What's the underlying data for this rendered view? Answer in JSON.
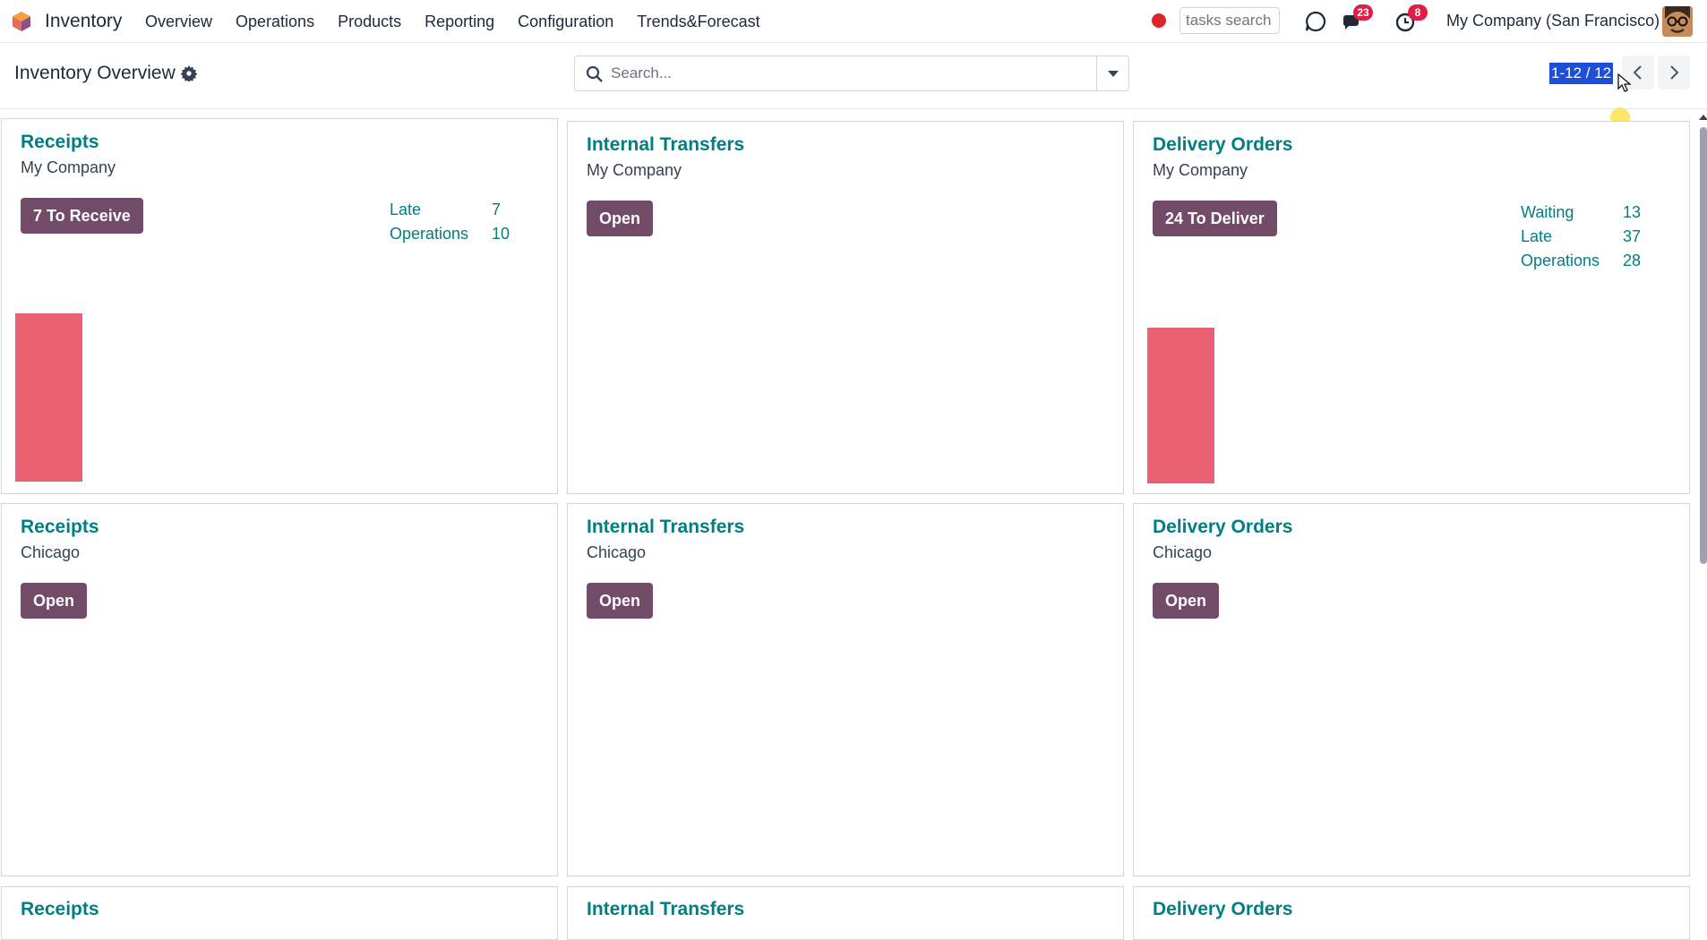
{
  "navbar": {
    "app_name": "Inventory",
    "menu": [
      "Overview",
      "Operations",
      "Products",
      "Reporting",
      "Configuration",
      "Trends&Forecast"
    ],
    "tasks_search_placeholder": "tasks search",
    "messages_count": "23",
    "activities_count": "8",
    "company": "My Company (San Francisco)"
  },
  "control": {
    "title": "Inventory Overview",
    "search_placeholder": "Search...",
    "pager": "1-12 / 12"
  },
  "cards": [
    {
      "title": "Receipts",
      "subtitle": "My Company",
      "button": "7 To Receive",
      "stats": [
        {
          "label": "Late",
          "value": "7"
        },
        {
          "label": "Operations",
          "value": "10"
        }
      ]
    },
    {
      "title": "Internal Transfers",
      "subtitle": "My Company",
      "button": "Open",
      "stats": []
    },
    {
      "title": "Delivery Orders",
      "subtitle": "My Company",
      "button": "24 To Deliver",
      "stats": [
        {
          "label": "Waiting",
          "value": "13"
        },
        {
          "label": "Late",
          "value": "37"
        },
        {
          "label": "Operations",
          "value": "28"
        }
      ]
    },
    {
      "title": "Receipts",
      "subtitle": "Chicago",
      "button": "Open",
      "stats": []
    },
    {
      "title": "Internal Transfers",
      "subtitle": "Chicago",
      "button": "Open",
      "stats": []
    },
    {
      "title": "Delivery Orders",
      "subtitle": "Chicago",
      "button": "Open",
      "stats": []
    },
    {
      "title": "Receipts",
      "subtitle": "",
      "button": "",
      "stats": []
    },
    {
      "title": "Internal Transfers",
      "subtitle": "",
      "button": "",
      "stats": []
    },
    {
      "title": "Delivery Orders",
      "subtitle": "",
      "button": "",
      "stats": []
    }
  ],
  "colors": {
    "brand": "#714b67",
    "link": "#017e84",
    "bar": "#e96173",
    "badge": "#e11d48"
  }
}
